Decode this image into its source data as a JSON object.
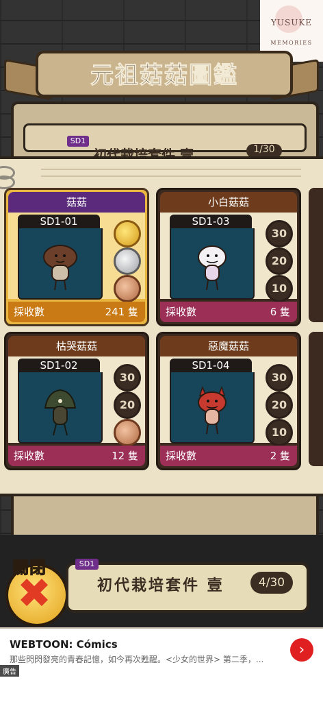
{
  "watermark": {
    "line1": "YUSUKE",
    "line2": "MEMORIES"
  },
  "title": "元祖菇菇圖鑑",
  "ghost_header": {
    "tag": "SD1",
    "title": "初代栽培套件 壹",
    "count": "1/30"
  },
  "cards": [
    {
      "name": "菇菇",
      "code": "SD1-01",
      "harvest_label": "採收數",
      "harvest_count": "241 隻",
      "selected": true,
      "medals": [
        "gold",
        "silver",
        "bronze"
      ]
    },
    {
      "name": "小白菇菇",
      "code": "SD1-03",
      "harvest_label": "採收數",
      "harvest_count": "6 隻",
      "selected": false,
      "medals": [
        "30",
        "20",
        "10"
      ]
    },
    {
      "name": "枯哭菇菇",
      "code": "SD1-02",
      "harvest_label": "採收數",
      "harvest_count": "12 隻",
      "selected": false,
      "medals": [
        "30",
        "20",
        "bronze"
      ]
    },
    {
      "name": "惡魔菇菇",
      "code": "SD1-04",
      "harvest_label": "採收數",
      "harvest_count": "2 隻",
      "selected": false,
      "medals": [
        "30",
        "20",
        "10"
      ]
    }
  ],
  "close_button": {
    "label": "關閉",
    "icon": "close-x-icon"
  },
  "set_bar": {
    "tag": "SD1",
    "title": "初代栽培套件 壹",
    "count": "4/30"
  },
  "ad": {
    "title": "WEBTOON: Cómics",
    "description": "那些閃閃發亮的青春記憶，如今再次甦醒。<少女的世界> 第二季，...",
    "badge": "廣告",
    "cta_icon": "chevron-right-icon"
  },
  "colors": {
    "purple_tag": "#6f2e8a",
    "card_foot": "#9b2f55",
    "selected_card": "#e9b642",
    "ad_cta": "#e02020"
  }
}
